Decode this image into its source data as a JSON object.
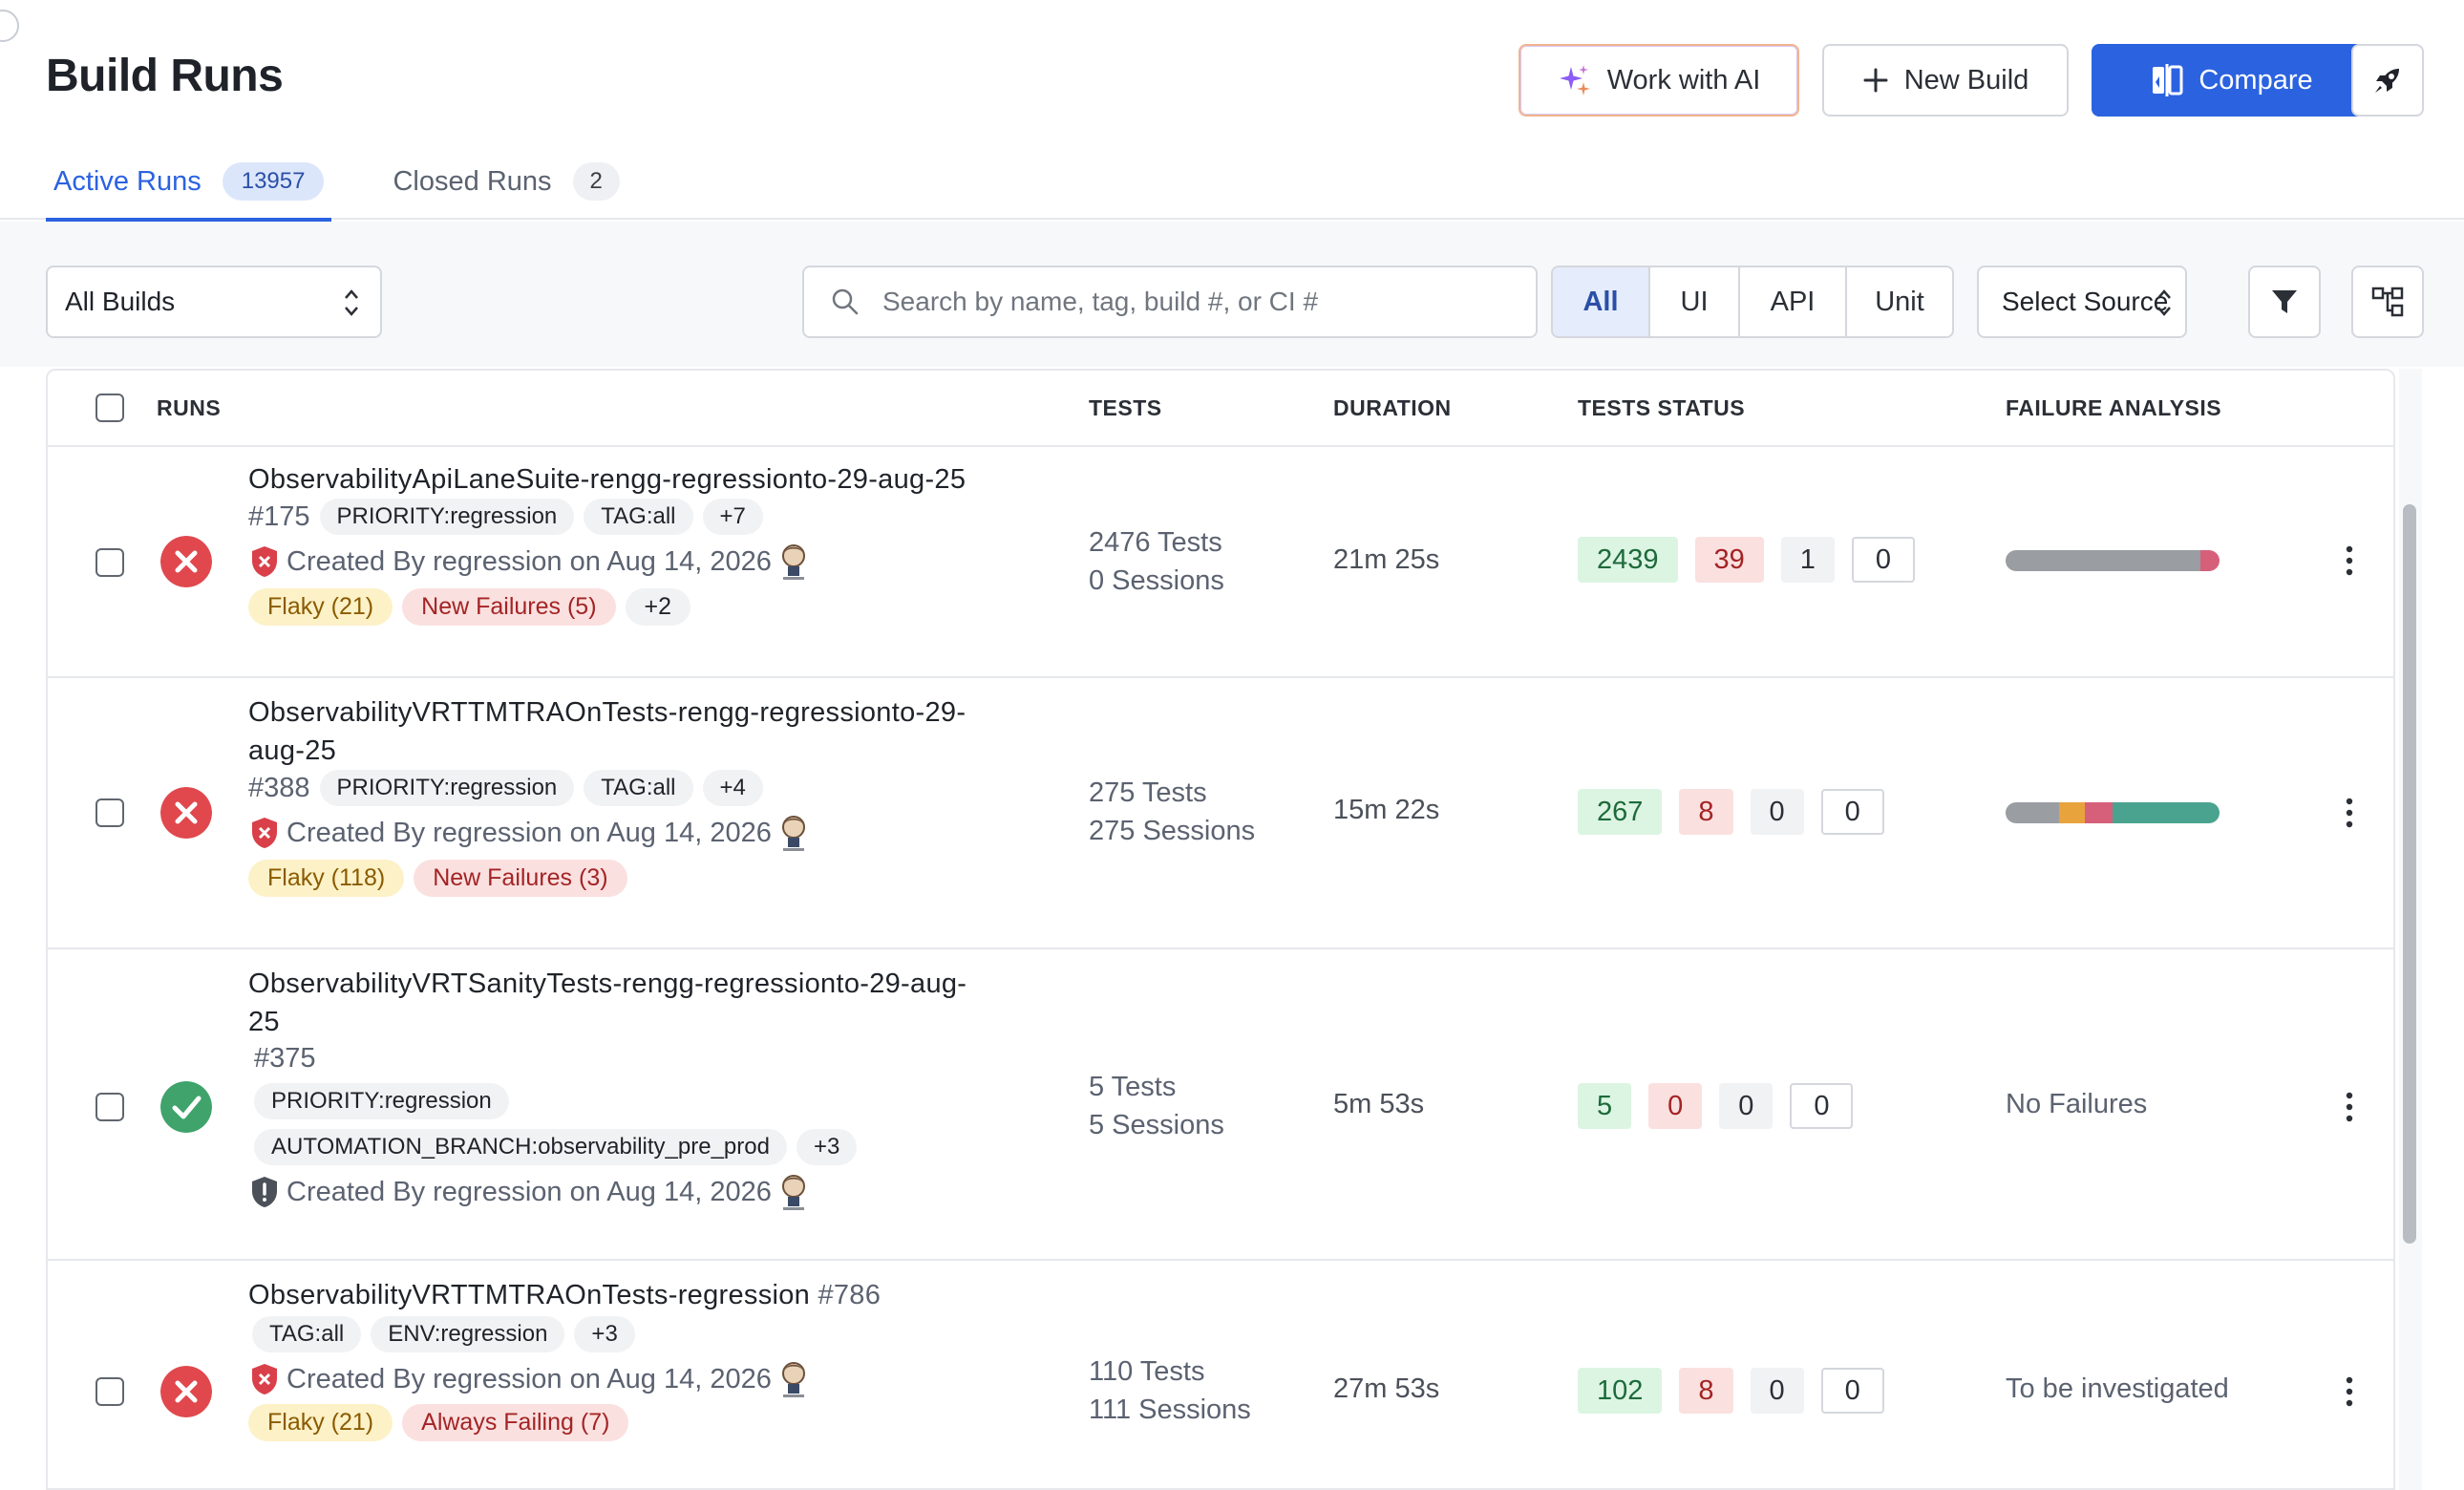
{
  "header": {
    "title": "Build Runs",
    "buttons": {
      "ai": "Work with AI",
      "new_build": "New Build",
      "compare": "Compare"
    },
    "tabs": [
      {
        "label": "Active Runs",
        "count": "13957",
        "active": true
      },
      {
        "label": "Closed Runs",
        "count": "2",
        "active": false
      }
    ]
  },
  "toolbar": {
    "builds_select": "All Builds",
    "search_placeholder": "Search by name, tag, build #, or CI #",
    "segments": [
      "All",
      "UI",
      "API",
      "Unit"
    ],
    "active_segment": "All",
    "source_select": "Select Source"
  },
  "table": {
    "headers": {
      "runs": "RUNS",
      "tests": "TESTS",
      "duration": "DURATION",
      "tests_status": "TESTS STATUS",
      "failure_analysis": "FAILURE ANALYSIS"
    },
    "rows": [
      {
        "status": "failed",
        "name_line1": "ObservabilityApiLaneSuite-rengg-regressionto-29-aug-25",
        "name_line2": "",
        "number": "#175",
        "tags": [
          "PRIORITY:regression",
          "TAG:all",
          "+7"
        ],
        "created": "Created By regression on Aug 14, 2026",
        "badges": [
          {
            "label": "Flaky (21)",
            "kind": "flaky"
          },
          {
            "label": "New Failures (5)",
            "kind": "fail"
          },
          {
            "label": "+2",
            "kind": "more"
          }
        ],
        "tests": "2476 Tests",
        "sessions": "0 Sessions",
        "duration": "21m 25s",
        "stats": {
          "passed": "2439",
          "failed": "39",
          "skipped": "1",
          "other": "0"
        },
        "failure_analysis": {
          "type": "bar",
          "segments": [
            {
              "share": 0.91,
              "color": "#9a9da2"
            },
            {
              "share": 0.09,
              "color": "#d6607a"
            }
          ]
        }
      },
      {
        "status": "failed",
        "name_line1": "ObservabilityVRTTMTRAOnTests-rengg-regressionto-29-",
        "name_line2": "aug-25",
        "number": "#388",
        "tags": [
          "PRIORITY:regression",
          "TAG:all",
          "+4"
        ],
        "created": "Created By regression on Aug 14, 2026",
        "badges": [
          {
            "label": "Flaky (118)",
            "kind": "flaky"
          },
          {
            "label": "New Failures (3)",
            "kind": "fail"
          }
        ],
        "tests": "275 Tests",
        "sessions": "275 Sessions",
        "duration": "15m 22s",
        "stats": {
          "passed": "267",
          "failed": "8",
          "skipped": "0",
          "other": "0"
        },
        "failure_analysis": {
          "type": "bar",
          "segments": [
            {
              "share": 0.25,
              "color": "#9a9da2"
            },
            {
              "share": 0.12,
              "color": "#e8a33c"
            },
            {
              "share": 0.13,
              "color": "#d6607a"
            },
            {
              "share": 0.5,
              "color": "#4aa38f"
            }
          ]
        }
      },
      {
        "status": "passed",
        "name_line1": "ObservabilityVRTSanityTests-rengg-regressionto-29-aug-",
        "name_line2": "25",
        "number": "#375",
        "tags": [
          "PRIORITY:regression"
        ],
        "tags_line2": [
          "AUTOMATION_BRANCH:observability_pre_prod",
          "+3"
        ],
        "created": "Created By regression on Aug 14, 2026",
        "badges": [],
        "tests": "5 Tests",
        "sessions": "5 Sessions",
        "duration": "5m 53s",
        "stats": {
          "passed": "5",
          "failed": "0",
          "skipped": "0",
          "other": "0"
        },
        "failure_analysis": {
          "type": "text",
          "text": "No Failures"
        }
      },
      {
        "status": "failed",
        "name_line1": "ObservabilityVRTTMTRAOnTests-regression",
        "name_line2": "",
        "number": "#786",
        "tags": [
          "TAG:all",
          "ENV:regression",
          "+3"
        ],
        "created": "Created By regression on Aug 14, 2026",
        "badges": [
          {
            "label": "Flaky (21)",
            "kind": "flaky"
          },
          {
            "label": "Always Failing (7)",
            "kind": "fail"
          }
        ],
        "tests": "110 Tests",
        "sessions": "111 Sessions",
        "duration": "27m 53s",
        "stats": {
          "passed": "102",
          "failed": "8",
          "skipped": "0",
          "other": "0"
        },
        "failure_analysis": {
          "type": "text",
          "text": "To be investigated"
        }
      }
    ]
  },
  "colors": {
    "primary": "#2b62e0",
    "failed": "#e0484d",
    "passed": "#3fa36b"
  }
}
